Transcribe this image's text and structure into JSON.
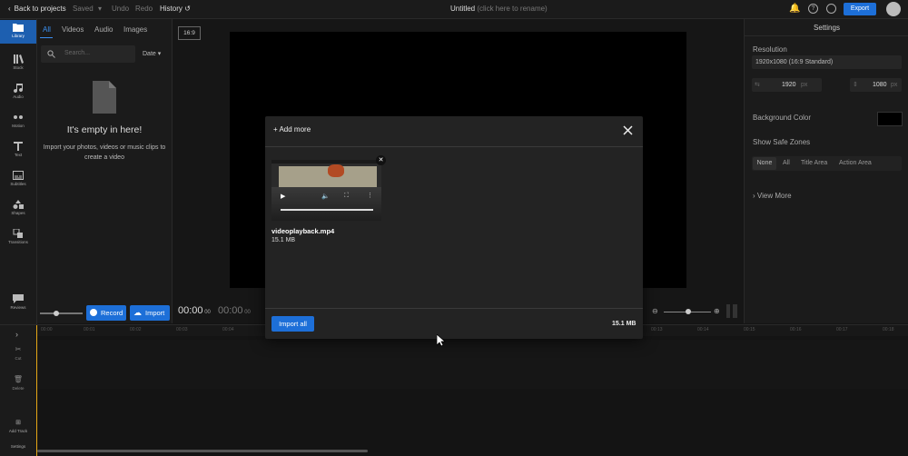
{
  "topbar": {
    "back": "Back to projects",
    "saved": "Saved",
    "undo": "Undo",
    "redo": "Redo",
    "history": "History",
    "title": "Untitled",
    "title_hint": "(click here to rename)",
    "export": "Export"
  },
  "nav": [
    {
      "label": "Library",
      "icon": "folder-icon"
    },
    {
      "label": "Stock",
      "icon": "stock-icon"
    },
    {
      "label": "Audio",
      "icon": "music-icon"
    },
    {
      "label": "Motion",
      "icon": "motion-icon"
    },
    {
      "label": "Text",
      "icon": "text-icon"
    },
    {
      "label": "Subtitles",
      "icon": "subtitles-icon"
    },
    {
      "label": "Shapes",
      "icon": "shapes-icon"
    },
    {
      "label": "Transitions",
      "icon": "transitions-icon"
    },
    {
      "label": "Reviews",
      "icon": "reviews-icon"
    }
  ],
  "library": {
    "tabs": [
      "All",
      "Videos",
      "Audio",
      "Images"
    ],
    "search_placeholder": "Search...",
    "sort": "Date",
    "empty_title": "It's empty in here!",
    "empty_desc": "Import your photos, videos or music clips to create a video",
    "record": "Record",
    "import": "Import"
  },
  "stage": {
    "aspect": "16:9",
    "time_current": "00:00",
    "time_current_frames": "00",
    "time_total": "00:00",
    "time_total_frames": "00"
  },
  "settings": {
    "title": "Settings",
    "resolution_label": "Resolution",
    "resolution_value": "1920x1080 (16:9 Standard)",
    "width": "1920",
    "height": "1080",
    "unit": "px",
    "bg_color_label": "Background Color",
    "bg_color": "#000000",
    "safe_zones_label": "Show Safe Zones",
    "safe_zones": [
      "None",
      "All",
      "Title Area",
      "Action Area"
    ],
    "view_more": "View More"
  },
  "timeline": {
    "ticks": [
      "00:00",
      "00:01",
      "00:02",
      "00:03",
      "00:04",
      "00:13",
      "00:14",
      "00:15",
      "00:16",
      "00:17",
      "00:18"
    ],
    "side": [
      {
        "label": "Cut",
        "icon": "scissors-icon"
      },
      {
        "label": "Delete",
        "icon": "trash-icon"
      },
      {
        "label": "Add Track",
        "icon": "add-track-icon"
      },
      {
        "label": "Settings",
        "icon": ""
      }
    ]
  },
  "modal": {
    "add_more": "Add more",
    "file_name": "videoplayback.mp4",
    "file_size": "15.1 MB",
    "import_all": "Import all",
    "total_size": "15.1 MB"
  },
  "colors": {
    "accent": "#1d6fd8",
    "active_tab": "#3b8ff0",
    "playhead": "#e6a817"
  }
}
